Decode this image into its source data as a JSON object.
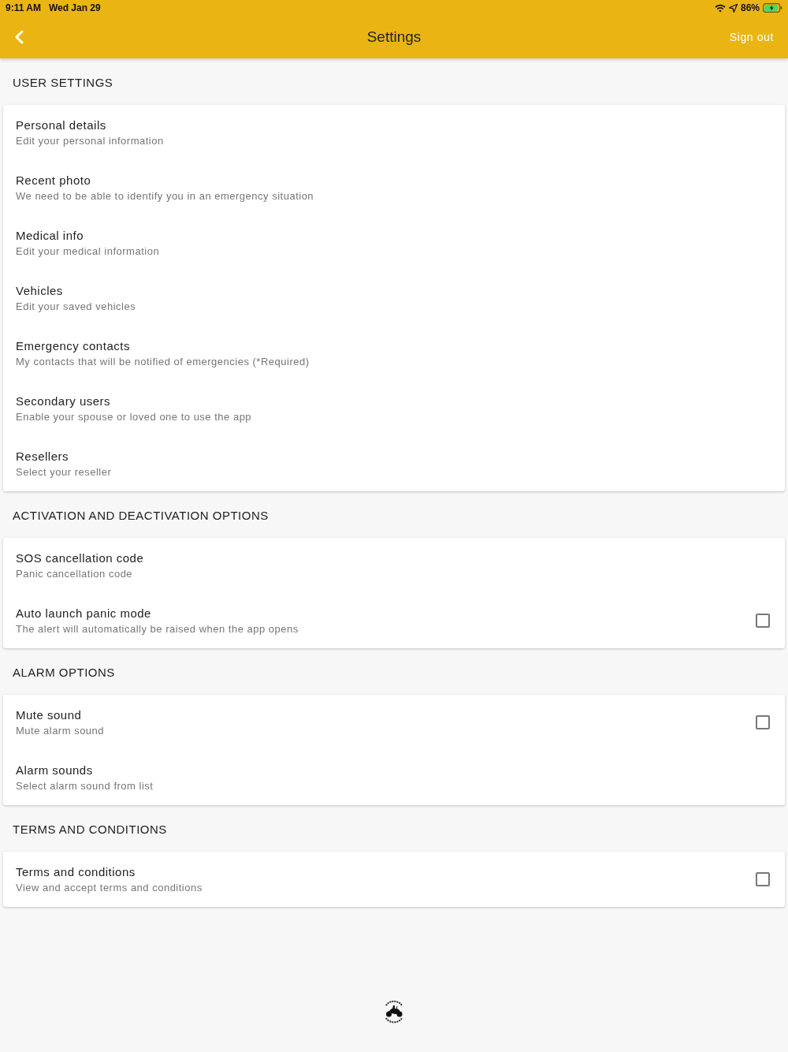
{
  "status_bar": {
    "time": "9:11 AM",
    "date": "Wed Jan 29",
    "battery_percent": "86%"
  },
  "header": {
    "title": "Settings",
    "action": "Sign out"
  },
  "sections": [
    {
      "title": "USER SETTINGS",
      "items": [
        {
          "kind": "link",
          "title": "Personal details",
          "subtitle": "Edit your personal information"
        },
        {
          "kind": "link",
          "title": "Recent photo",
          "subtitle": "We need to be able to identify you in an emergency situation"
        },
        {
          "kind": "link",
          "title": "Medical info",
          "subtitle": "Edit your medical information"
        },
        {
          "kind": "link",
          "title": "Vehicles",
          "subtitle": "Edit your saved vehicles"
        },
        {
          "kind": "link",
          "title": "Emergency contacts",
          "subtitle": "My contacts that will be notified of emergencies (*Required)"
        },
        {
          "kind": "link",
          "title": "Secondary users",
          "subtitle": "Enable your spouse or loved one to use the app"
        },
        {
          "kind": "link",
          "title": "Resellers",
          "subtitle": "Select your reseller"
        }
      ]
    },
    {
      "title": "ACTIVATION AND DEACTIVATION OPTIONS",
      "items": [
        {
          "kind": "link",
          "title": "SOS cancellation code",
          "subtitle": "Panic cancellation code"
        },
        {
          "kind": "checkbox",
          "title": "Auto launch panic mode",
          "subtitle": "The alert will automatically be raised when the app opens",
          "checked": false
        }
      ]
    },
    {
      "title": "ALARM OPTIONS",
      "items": [
        {
          "kind": "checkbox",
          "title": "Mute sound",
          "subtitle": "Mute alarm sound",
          "checked": false
        },
        {
          "kind": "link",
          "title": "Alarm sounds",
          "subtitle": "Select alarm sound from list"
        }
      ]
    },
    {
      "title": "TERMS AND CONDITIONS",
      "items": [
        {
          "kind": "checkbox",
          "title": "Terms and conditions",
          "subtitle": "View and accept terms and conditions",
          "checked": false
        }
      ]
    }
  ]
}
